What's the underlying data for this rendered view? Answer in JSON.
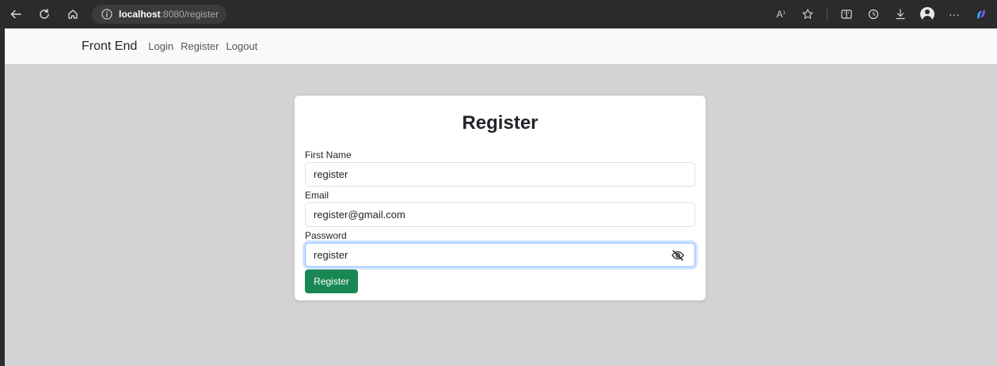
{
  "browser": {
    "address_host": "localhost",
    "address_path": ":8080/register",
    "icons": [
      "back-icon",
      "refresh-icon",
      "home-icon",
      "info-icon",
      "read-aloud-icon",
      "favorite-icon",
      "split-screen-icon",
      "history-icon",
      "download-icon",
      "profile-icon",
      "more-icon",
      "copilot-icon"
    ],
    "read_aloud_glyph": "A⁾",
    "more_glyph": "···"
  },
  "navbar": {
    "brand": "Front End",
    "links": [
      "Login",
      "Register",
      "Logout"
    ]
  },
  "card": {
    "title": "Register",
    "first_name_label": "First Name",
    "first_name_value": "register",
    "email_label": "Email",
    "email_value": "register@gmail.com",
    "password_label": "Password",
    "password_value": "register",
    "submit_label": "Register"
  },
  "colors": {
    "chrome_bg": "#2b2b2b",
    "navbar_bg": "#f8f9fa",
    "content_bg": "#d3d3d3",
    "button_bg": "#198754",
    "focus_border": "#86b7fe"
  }
}
